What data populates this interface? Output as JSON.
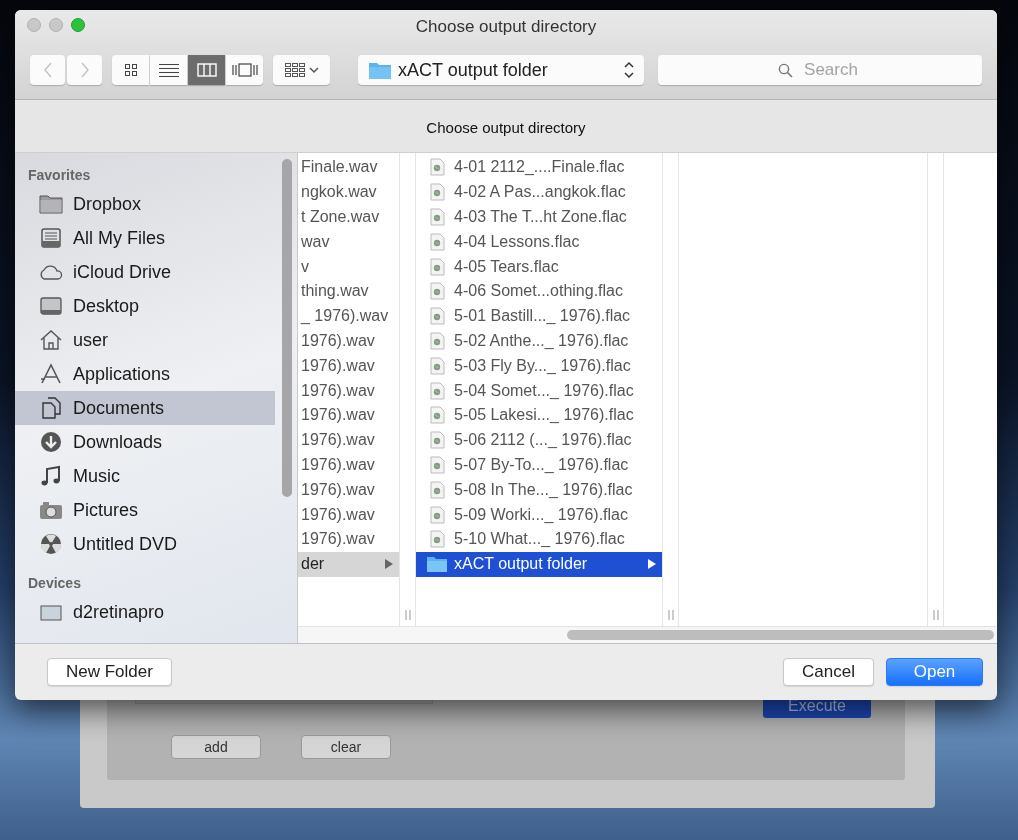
{
  "dialog": {
    "title": "Choose output directory",
    "message": "Choose output directory"
  },
  "toolbar": {
    "nav": [
      {
        "kind": "back",
        "disabled": true
      },
      {
        "kind": "forward",
        "disabled": true
      }
    ],
    "views": [
      {
        "kind": "icons",
        "selected": false
      },
      {
        "kind": "list",
        "selected": false
      },
      {
        "kind": "columns",
        "selected": true
      },
      {
        "kind": "coverflow",
        "selected": false
      }
    ],
    "path_popup": {
      "label": "xACT output folder"
    },
    "search": {
      "placeholder": "Search"
    }
  },
  "sidebar": {
    "sections": [
      {
        "title": "Favorites",
        "items": [
          {
            "label": "Dropbox",
            "kind": "folder",
            "selected": false
          },
          {
            "label": "All My Files",
            "kind": "files",
            "selected": false
          },
          {
            "label": "iCloud Drive",
            "kind": "cloud",
            "selected": false
          },
          {
            "label": "Desktop",
            "kind": "desktop",
            "selected": false
          },
          {
            "label": "user",
            "kind": "home",
            "selected": false
          },
          {
            "label": "Applications",
            "kind": "apps",
            "selected": false
          },
          {
            "label": "Documents",
            "kind": "documents",
            "selected": true
          },
          {
            "label": "Downloads",
            "kind": "downloads",
            "selected": false
          },
          {
            "label": "Music",
            "kind": "music",
            "selected": false
          },
          {
            "label": "Pictures",
            "kind": "camera",
            "selected": false
          },
          {
            "label": "Untitled DVD",
            "kind": "disc",
            "selected": false
          }
        ]
      },
      {
        "title": "Devices",
        "items": [
          {
            "label": "d2retinapro",
            "kind": "computer",
            "selected": false
          }
        ]
      }
    ]
  },
  "columns": [
    {
      "active": false,
      "icons_visible": false,
      "rows": [
        {
          "label": "Finale.wav",
          "kind": "file",
          "selected": false
        },
        {
          "label": "ngkok.wav",
          "kind": "file",
          "selected": false
        },
        {
          "label": "t Zone.wav",
          "kind": "file",
          "selected": false
        },
        {
          "label": "wav",
          "kind": "file",
          "selected": false
        },
        {
          "label": "v",
          "kind": "file",
          "selected": false
        },
        {
          "label": "thing.wav",
          "kind": "file",
          "selected": false
        },
        {
          "label": "_ 1976).wav",
          "kind": "file",
          "selected": false
        },
        {
          "label": "1976).wav",
          "kind": "file",
          "selected": false
        },
        {
          "label": "1976).wav",
          "kind": "file",
          "selected": false
        },
        {
          "label": "1976).wav",
          "kind": "file",
          "selected": false
        },
        {
          "label": "1976).wav",
          "kind": "file",
          "selected": false
        },
        {
          "label": "1976).wav",
          "kind": "file",
          "selected": false
        },
        {
          "label": "1976).wav",
          "kind": "file",
          "selected": false
        },
        {
          "label": "1976).wav",
          "kind": "file",
          "selected": false
        },
        {
          "label": "1976).wav",
          "kind": "file",
          "selected": false
        },
        {
          "label": "1976).wav",
          "kind": "file",
          "selected": false
        },
        {
          "label": "der",
          "kind": "folder",
          "selected": true
        }
      ]
    },
    {
      "active": true,
      "icons_visible": true,
      "rows": [
        {
          "label": "4-01 2112_....Finale.flac",
          "kind": "file",
          "selected": false
        },
        {
          "label": "4-02 A Pas...angkok.flac",
          "kind": "file",
          "selected": false
        },
        {
          "label": "4-03 The T...ht Zone.flac",
          "kind": "file",
          "selected": false
        },
        {
          "label": "4-04 Lessons.flac",
          "kind": "file",
          "selected": false
        },
        {
          "label": "4-05 Tears.flac",
          "kind": "file",
          "selected": false
        },
        {
          "label": "4-06 Somet...othing.flac",
          "kind": "file",
          "selected": false
        },
        {
          "label": "5-01 Bastill..._ 1976).flac",
          "kind": "file",
          "selected": false
        },
        {
          "label": "5-02 Anthe..._ 1976).flac",
          "kind": "file",
          "selected": false
        },
        {
          "label": "5-03 Fly By..._ 1976).flac",
          "kind": "file",
          "selected": false
        },
        {
          "label": "5-04 Somet..._ 1976).flac",
          "kind": "file",
          "selected": false
        },
        {
          "label": "5-05 Lakesi..._ 1976).flac",
          "kind": "file",
          "selected": false
        },
        {
          "label": "5-06 2112 (..._ 1976).flac",
          "kind": "file",
          "selected": false
        },
        {
          "label": "5-07 By-To..._ 1976).flac",
          "kind": "file",
          "selected": false
        },
        {
          "label": "5-08 In The..._ 1976).flac",
          "kind": "file",
          "selected": false
        },
        {
          "label": "5-09 Worki..._ 1976).flac",
          "kind": "file",
          "selected": false
        },
        {
          "label": "5-10 What..._ 1976).flac",
          "kind": "file",
          "selected": false
        },
        {
          "label": "xACT output folder",
          "kind": "folder",
          "selected": true
        }
      ]
    }
  ],
  "footer": {
    "new_folder": "New Folder",
    "cancel": "Cancel",
    "open": "Open"
  },
  "background_window": {
    "execute": "Execute",
    "add": "add",
    "clear": "clear"
  }
}
